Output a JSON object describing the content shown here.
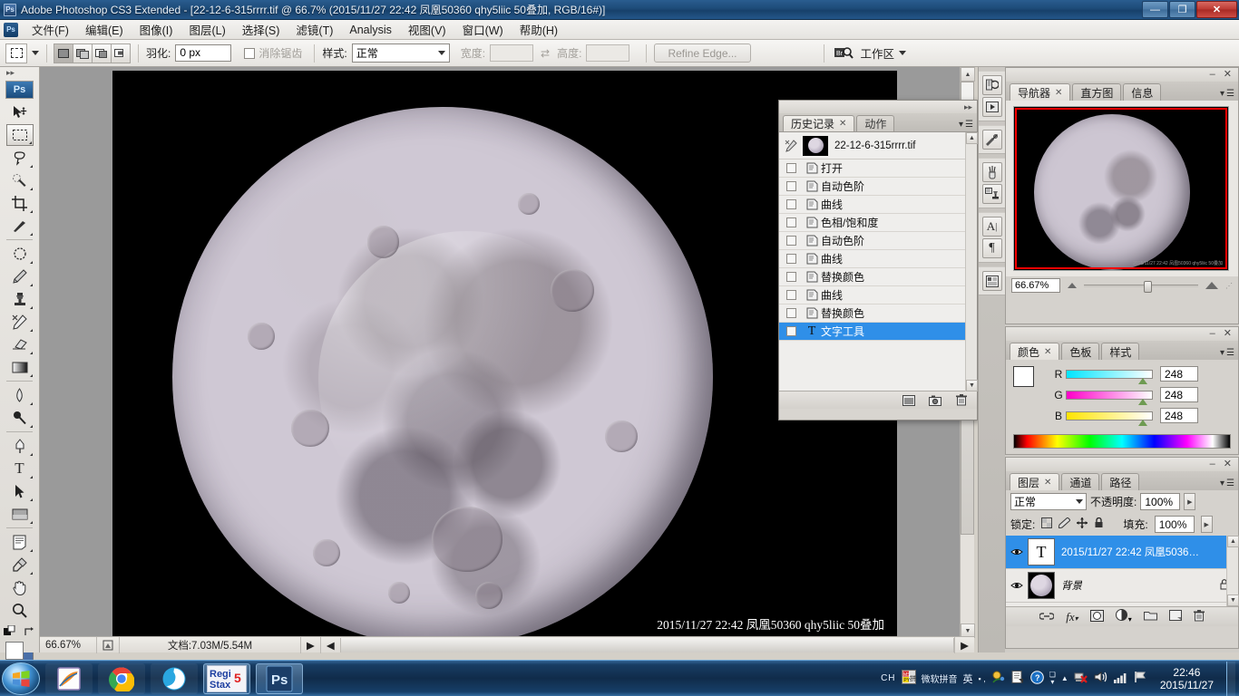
{
  "window": {
    "title": "Adobe Photoshop CS3 Extended - [22-12-6-315rrrr.tif @ 66.7% (2015/11/27 22:42  凤凰50360 qhy5liic 50叠加, RGB/16#)]",
    "minimize": "—",
    "restore": "❐",
    "close": "✕"
  },
  "menu": {
    "items": [
      "文件(F)",
      "编辑(E)",
      "图像(I)",
      "图层(L)",
      "选择(S)",
      "滤镜(T)",
      "Analysis",
      "视图(V)",
      "窗口(W)",
      "帮助(H)"
    ]
  },
  "options_bar": {
    "feather_label": "羽化:",
    "feather_value": "0 px",
    "antialias_label": "消除锯齿",
    "style_label": "样式:",
    "style_value": "正常",
    "width_label": "宽度:",
    "width_value": "",
    "height_label": "高度:",
    "height_value": "",
    "swap_icon": "⇄",
    "refine_edge": "Refine Edge...",
    "bridge_icon": "Br",
    "workspace_label": "工作区"
  },
  "toolbox": {
    "logo": "Ps",
    "tools": [
      {
        "name": "move-tool",
        "glyph": "➤"
      },
      {
        "name": "rectangular-marquee-tool",
        "glyph": "▭",
        "selected": true
      },
      {
        "name": "lasso-tool",
        "glyph": "🖉"
      },
      {
        "name": "quick-selection-tool",
        "glyph": "✎"
      },
      {
        "name": "crop-tool",
        "glyph": "⌗"
      },
      {
        "name": "slice-tool",
        "glyph": "✂"
      },
      {
        "name": "healing-brush-tool",
        "glyph": "◌"
      },
      {
        "name": "brush-tool",
        "glyph": "🖌"
      },
      {
        "name": "clone-stamp-tool",
        "glyph": "⚑"
      },
      {
        "name": "history-brush-tool",
        "glyph": "✒"
      },
      {
        "name": "eraser-tool",
        "glyph": "▱"
      },
      {
        "name": "gradient-tool",
        "glyph": "▦"
      },
      {
        "name": "blur-tool",
        "glyph": "💧"
      },
      {
        "name": "dodge-tool",
        "glyph": "🝊"
      },
      {
        "name": "pen-tool",
        "glyph": "✑"
      },
      {
        "name": "type-tool",
        "glyph": "T"
      },
      {
        "name": "path-selection-tool",
        "glyph": "➤"
      },
      {
        "name": "rectangle-tool",
        "glyph": "▬"
      },
      {
        "name": "notes-tool",
        "glyph": "🗒"
      },
      {
        "name": "eyedropper-tool",
        "glyph": "💉"
      },
      {
        "name": "hand-tool",
        "glyph": "✋"
      },
      {
        "name": "zoom-tool",
        "glyph": "🔍"
      }
    ],
    "foreground_color": "#ffffff",
    "background_color": "#4a6fa8"
  },
  "history_panel": {
    "tabs": [
      {
        "label": "历史记录",
        "active": true,
        "closable": true
      },
      {
        "label": "动作",
        "active": false,
        "closable": false
      }
    ],
    "source_name": "22-12-6-315rrrr.tif",
    "items": [
      {
        "label": "打开",
        "selected": false
      },
      {
        "label": "自动色阶",
        "selected": false
      },
      {
        "label": "曲线",
        "selected": false
      },
      {
        "label": "色相/饱和度",
        "selected": false
      },
      {
        "label": "自动色阶",
        "selected": false
      },
      {
        "label": "曲线",
        "selected": false
      },
      {
        "label": "替换颜色",
        "selected": false
      },
      {
        "label": "曲线",
        "selected": false
      },
      {
        "label": "替换颜色",
        "selected": false
      },
      {
        "label": "文字工具",
        "selected": true
      }
    ],
    "footer_icons": [
      "new-document-icon",
      "new-snapshot-icon",
      "delete-icon"
    ]
  },
  "icon_dock": {
    "icons": [
      "history-dock-icon",
      "actions-dock-icon",
      "tool-presets-icon",
      "brushes-icon",
      "clone-source-icon",
      "character-icon",
      "paragraph-icon",
      "layer-comps-icon"
    ]
  },
  "navigator_panel": {
    "tabs": [
      {
        "label": "导航器",
        "active": true,
        "closable": true
      },
      {
        "label": "直方图",
        "active": false,
        "closable": false
      },
      {
        "label": "信息",
        "active": false,
        "closable": false
      }
    ],
    "zoom_value": "66.67%"
  },
  "color_panel": {
    "tabs": [
      {
        "label": "颜色",
        "active": true,
        "closable": true
      },
      {
        "label": "色板",
        "active": false,
        "closable": false
      },
      {
        "label": "样式",
        "active": false,
        "closable": false
      }
    ],
    "channels": [
      {
        "label": "R",
        "value": "248"
      },
      {
        "label": "G",
        "value": "248"
      },
      {
        "label": "B",
        "value": "248"
      }
    ],
    "foreground": "#ffffff",
    "background": "#4a6fa8"
  },
  "layers_panel": {
    "tabs": [
      {
        "label": "图层",
        "active": true,
        "closable": true
      },
      {
        "label": "通道",
        "active": false,
        "closable": false
      },
      {
        "label": "路径",
        "active": false,
        "closable": false
      }
    ],
    "blend_mode": "正常",
    "opacity_label": "不透明度:",
    "opacity_value": "100%",
    "lock_label": "锁定:",
    "fill_label": "填充:",
    "fill_value": "100%",
    "lock_icons": [
      "lock-transparent-icon",
      "lock-image-icon",
      "lock-position-icon",
      "lock-all-icon"
    ],
    "layers": [
      {
        "name": "2015/11/27 22:42  凤凰5036…",
        "type": "text",
        "selected": true,
        "visible": true,
        "locked": false
      },
      {
        "name": "背景",
        "type": "image",
        "selected": false,
        "visible": true,
        "locked": true
      }
    ],
    "footer_icons": [
      "link-layers-icon",
      "layer-style-icon",
      "layer-mask-icon",
      "adjustment-layer-icon",
      "new-group-icon",
      "new-layer-icon",
      "delete-layer-icon"
    ]
  },
  "document": {
    "zoom": "66.67%",
    "doc_size_label": "文档:7.03M/5.54M",
    "watermark": "2015/11/27 22:42  凤凰50360 qhy5liic 50叠加"
  },
  "taskbar": {
    "start_icon": "windows-start-icon",
    "items": [
      {
        "name": "foxit-reader-icon",
        "label": ""
      },
      {
        "name": "google-chrome-icon",
        "label": ""
      },
      {
        "name": "qq-browser-icon",
        "label": ""
      },
      {
        "name": "registax-icon",
        "label": "Regi Stax 5"
      },
      {
        "name": "photoshop-icon",
        "label": "Ps"
      }
    ],
    "tray": {
      "language": "CH",
      "ime_label": "微软拼音",
      "ime_mode": "英",
      "icons": [
        "ime-icon",
        "notes-icon",
        "help-icon",
        "expand-icon",
        "network-error-icon",
        "volume-icon",
        "signal-icon",
        "flag-icon"
      ]
    },
    "time": "22:46",
    "date": "2015/11/27"
  }
}
